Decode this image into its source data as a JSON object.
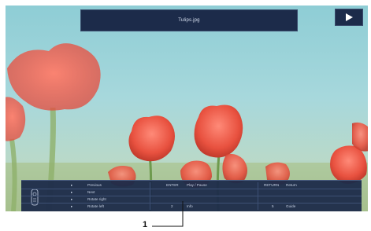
{
  "viewer": {
    "file_name": "Tulips.jpg",
    "play_icon": "play-icon",
    "remote_icon": "remote-icon"
  },
  "guide": {
    "rows": [
      {
        "arrow": "▸",
        "action": "Previous",
        "key2": "ENTER",
        "action2": "Play / Pause",
        "key3": "RETURN",
        "action3": "Return"
      },
      {
        "arrow": "▸",
        "action": "Next",
        "key2": "",
        "action2": "",
        "key3": "",
        "action3": ""
      },
      {
        "arrow": "▸",
        "action": "Rotate right",
        "key2": "",
        "action2": "",
        "key3": "",
        "action3": ""
      },
      {
        "arrow": "▸",
        "action": "Rotate left",
        "key2": "2",
        "action2": "Info",
        "key3": "5",
        "action3": "Guide"
      }
    ]
  },
  "callout": {
    "label": "1"
  }
}
